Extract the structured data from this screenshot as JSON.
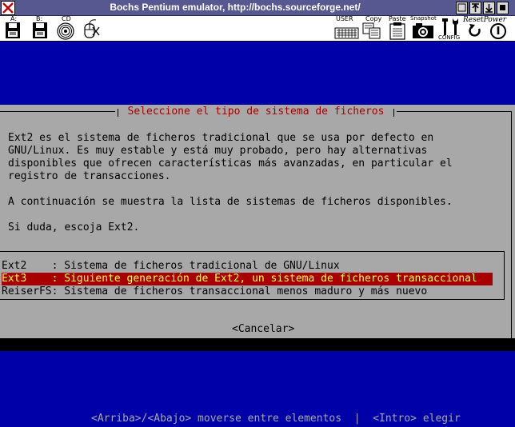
{
  "window": {
    "title": "Bochs Pentium emulator, http://bochs.sourceforge.net/"
  },
  "toolbar": {
    "floppy_a_label": "A:",
    "floppy_b_label": "B:",
    "cdrom_label": "CD",
    "user_label": "USER",
    "copy_label": "Copy",
    "paste_label": "Paste",
    "snapshot_label": "Snapshot",
    "config_label": "CONFIG",
    "reset_label": "ResetPower"
  },
  "dialog": {
    "title": "Seleccione el tipo de sistema de ficheros",
    "paragraph1": [
      "Ext2 es el sistema de ficheros tradicional que se usa por defecto en",
      "GNU/Linux. Es muy estable y está muy probado, pero hay alternativas",
      "disponibles que ofrecen características más avanzadas, en particular el",
      "registro de transacciones."
    ],
    "paragraph2": "A continuación se muestra la lista de sistemas de ficheros disponibles.",
    "paragraph3": "Si duda, escoja Ext2.",
    "options": [
      {
        "name": "Ext2",
        "description": "Sistema de ficheros tradicional de GNU/Linux",
        "selected": false
      },
      {
        "name": "Ext3",
        "description": "Siguiente generación de Ext2, un sistema de ficheros transaccional",
        "selected": true
      },
      {
        "name": "ReiserFS",
        "description": "Sistema de ficheros transaccional menos maduro y más nuevo",
        "selected": false
      }
    ],
    "option_lines": [
      "Ext2    : Sistema de ficheros tradicional de GNU/Linux",
      "Ext3    : Siguiente generación de Ext2, un sistema de ficheros transaccional",
      "ReiserFS: Sistema de ficheros transaccional menos maduro y más nuevo"
    ],
    "cancel_label": "<Cancelar>"
  },
  "footer": {
    "help": "<Arriba>/<Abajo> moverse entre elementos  |  <Intro> elegir"
  },
  "colors": {
    "screen_bg": "#0000a8",
    "dialog_bg": "#a8a8a8",
    "title_text": "#a80000",
    "selection_bg": "#a80000",
    "selection_text": "#ffff54"
  },
  "icons": [
    "close-icon",
    "floppy-icon",
    "cdrom-icon",
    "mouse-icon",
    "keyboard-icon",
    "copy-icon",
    "paste-icon",
    "camera-icon",
    "config-icon",
    "reset-icon",
    "power-icon"
  ]
}
